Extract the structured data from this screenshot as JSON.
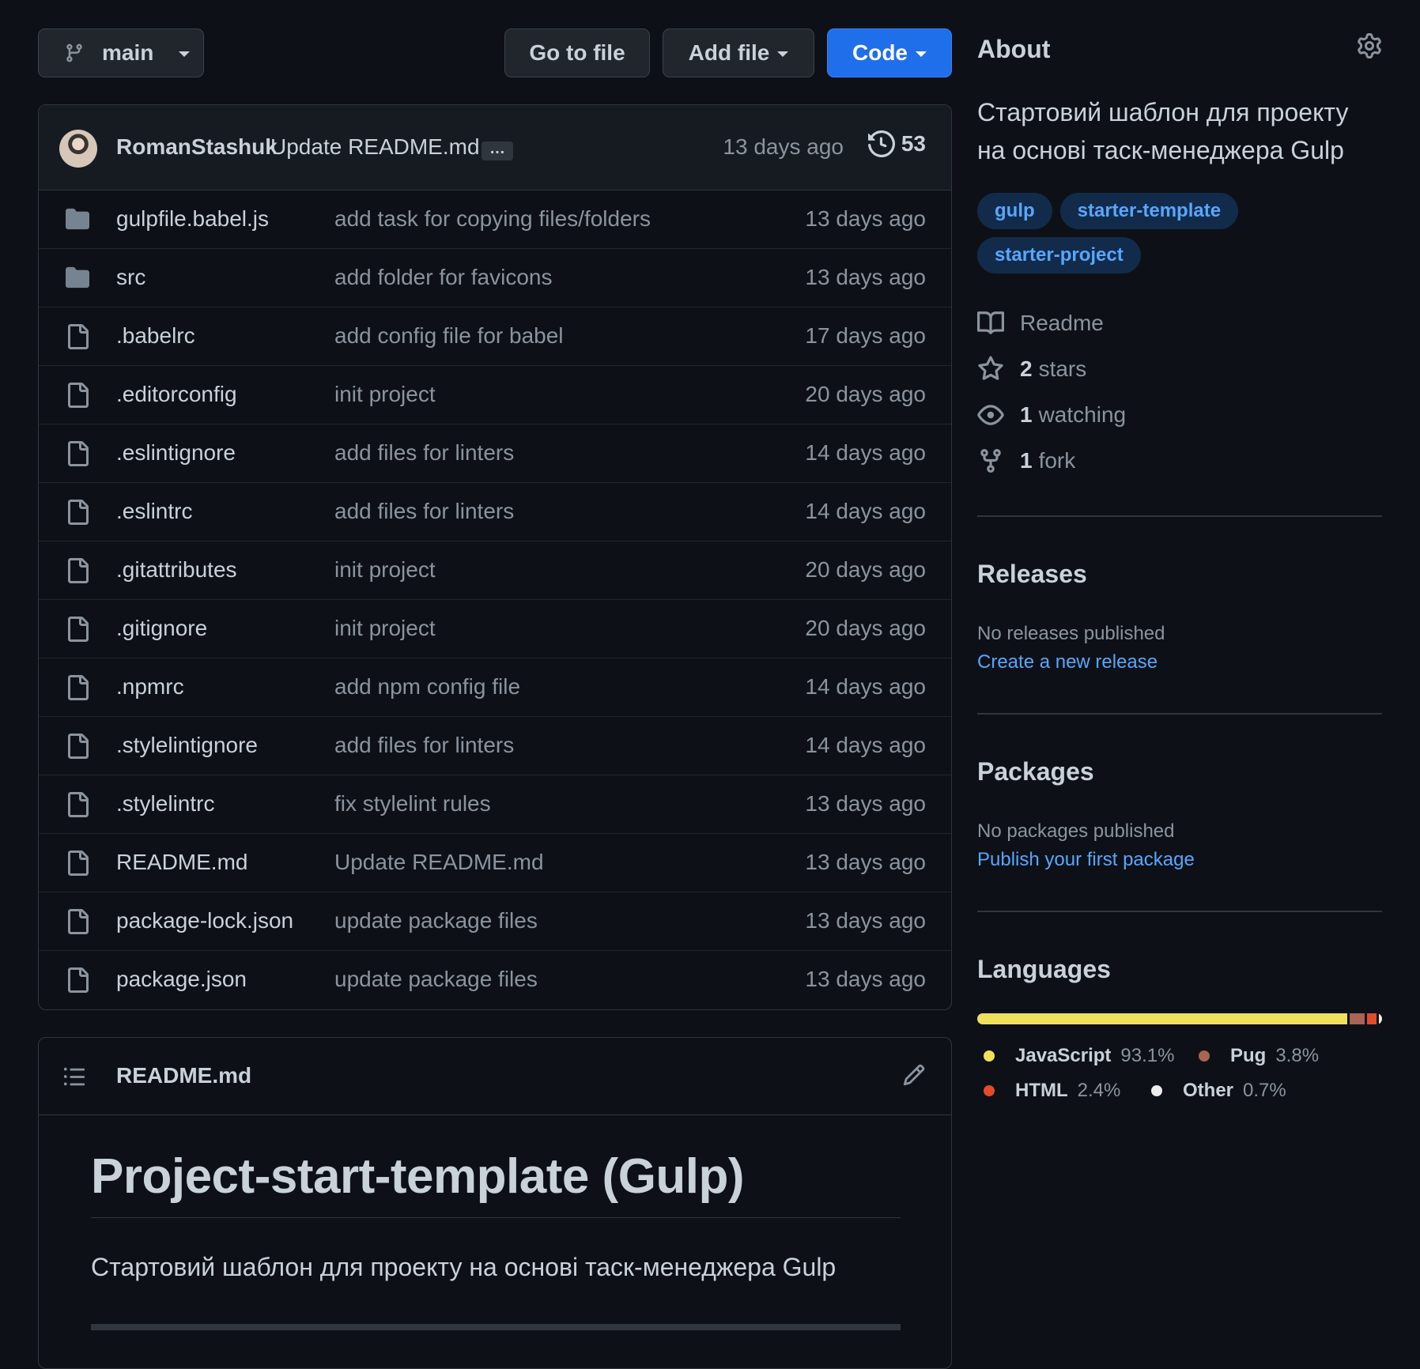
{
  "toolbar": {
    "branch_label": "main",
    "goto_label": "Go to file",
    "add_label": "Add file",
    "code_label": "Code"
  },
  "commit": {
    "author": "RomanStashuk",
    "message": "Update README.md",
    "ellipsis": "…",
    "time": "13 days ago",
    "count": "53"
  },
  "files": [
    {
      "name": "gulpfile.babel.js",
      "message": "add task for copying files/folders",
      "time": "13 days ago",
      "type": "folder"
    },
    {
      "name": "src",
      "message": "add folder for favicons",
      "time": "13 days ago",
      "type": "folder"
    },
    {
      "name": ".babelrc",
      "message": "add config file for babel",
      "time": "17 days ago",
      "type": "file"
    },
    {
      "name": ".editorconfig",
      "message": "init project",
      "time": "20 days ago",
      "type": "file"
    },
    {
      "name": ".eslintignore",
      "message": "add files for linters",
      "time": "14 days ago",
      "type": "file"
    },
    {
      "name": ".eslintrc",
      "message": "add files for linters",
      "time": "14 days ago",
      "type": "file"
    },
    {
      "name": ".gitattributes",
      "message": "init project",
      "time": "20 days ago",
      "type": "file"
    },
    {
      "name": ".gitignore",
      "message": "init project",
      "time": "20 days ago",
      "type": "file"
    },
    {
      "name": ".npmrc",
      "message": "add npm config file",
      "time": "14 days ago",
      "type": "file"
    },
    {
      "name": ".stylelintignore",
      "message": "add files for linters",
      "time": "14 days ago",
      "type": "file"
    },
    {
      "name": ".stylelintrc",
      "message": "fix stylelint rules",
      "time": "13 days ago",
      "type": "file"
    },
    {
      "name": "README.md",
      "message": "Update README.md",
      "time": "13 days ago",
      "type": "file"
    },
    {
      "name": "package-lock.json",
      "message": "update package files",
      "time": "13 days ago",
      "type": "file"
    },
    {
      "name": "package.json",
      "message": "update package files",
      "time": "13 days ago",
      "type": "file"
    }
  ],
  "readme": {
    "filename": "README.md",
    "heading": "Project-start-template (Gulp)",
    "paragraph": "Стартовий шаблон для проекту на основі таск-менеджера Gulp"
  },
  "about": {
    "title": "About",
    "description": "Стартовий шаблон для проекту на основі таск-менеджера Gulp",
    "topics": [
      "gulp",
      "starter-template",
      "starter-project"
    ],
    "readme_label": "Readme",
    "stars_count": "2",
    "stars_label": "stars",
    "watching_count": "1",
    "watching_label": "watching",
    "fork_count": "1",
    "fork_label": "fork"
  },
  "releases": {
    "title": "Releases",
    "empty": "No releases published",
    "link": "Create a new release"
  },
  "packages": {
    "title": "Packages",
    "empty": "No packages published",
    "link": "Publish your first package"
  },
  "languages": {
    "title": "Languages",
    "items": [
      {
        "name": "JavaScript",
        "percent": "93.1%",
        "value": 93.1,
        "color": "#f1e05a"
      },
      {
        "name": "Pug",
        "percent": "3.8%",
        "value": 3.8,
        "color": "#a86454"
      },
      {
        "name": "HTML",
        "percent": "2.4%",
        "value": 2.4,
        "color": "#e34c26"
      },
      {
        "name": "Other",
        "percent": "0.7%",
        "value": 0.7,
        "color": "#ededed"
      }
    ]
  },
  "colors": {
    "background": "#0d1117",
    "accent": "#1f6feb",
    "link": "#58a6ff",
    "border": "#30363d"
  }
}
